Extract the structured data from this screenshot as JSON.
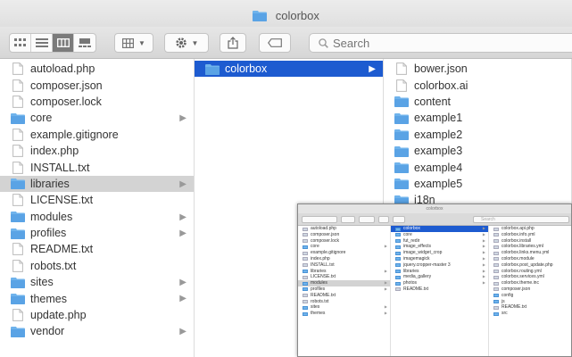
{
  "window": {
    "title": "colorbox",
    "search": {
      "placeholder": "Search"
    }
  },
  "columns": [
    {
      "items": [
        {
          "label": "autoload.php",
          "type": "file",
          "chevron": false,
          "selected": ""
        },
        {
          "label": "composer.json",
          "type": "file",
          "chevron": false,
          "selected": ""
        },
        {
          "label": "composer.lock",
          "type": "file",
          "chevron": false,
          "selected": ""
        },
        {
          "label": "core",
          "type": "folder",
          "chevron": true,
          "selected": ""
        },
        {
          "label": "example.gitignore",
          "type": "file",
          "chevron": false,
          "selected": ""
        },
        {
          "label": "index.php",
          "type": "file",
          "chevron": false,
          "selected": ""
        },
        {
          "label": "INSTALL.txt",
          "type": "file",
          "chevron": false,
          "selected": ""
        },
        {
          "label": "libraries",
          "type": "folder",
          "chevron": true,
          "selected": "gray"
        },
        {
          "label": "LICENSE.txt",
          "type": "file",
          "chevron": false,
          "selected": ""
        },
        {
          "label": "modules",
          "type": "folder",
          "chevron": true,
          "selected": ""
        },
        {
          "label": "profiles",
          "type": "folder",
          "chevron": true,
          "selected": ""
        },
        {
          "label": "README.txt",
          "type": "file",
          "chevron": false,
          "selected": ""
        },
        {
          "label": "robots.txt",
          "type": "file",
          "chevron": false,
          "selected": ""
        },
        {
          "label": "sites",
          "type": "folder",
          "chevron": true,
          "selected": ""
        },
        {
          "label": "themes",
          "type": "folder",
          "chevron": true,
          "selected": ""
        },
        {
          "label": "update.php",
          "type": "file",
          "chevron": false,
          "selected": ""
        },
        {
          "label": "vendor",
          "type": "folder",
          "chevron": true,
          "selected": ""
        }
      ]
    },
    {
      "items": [
        {
          "label": "colorbox",
          "type": "folder",
          "chevron": true,
          "selected": "blue"
        }
      ]
    },
    {
      "items": [
        {
          "label": "bower.json",
          "type": "file",
          "chevron": false,
          "selected": ""
        },
        {
          "label": "colorbox.ai",
          "type": "file",
          "chevron": false,
          "selected": ""
        },
        {
          "label": "content",
          "type": "folder",
          "chevron": false,
          "selected": ""
        },
        {
          "label": "example1",
          "type": "folder",
          "chevron": false,
          "selected": ""
        },
        {
          "label": "example2",
          "type": "folder",
          "chevron": false,
          "selected": ""
        },
        {
          "label": "example3",
          "type": "folder",
          "chevron": false,
          "selected": ""
        },
        {
          "label": "example4",
          "type": "folder",
          "chevron": false,
          "selected": ""
        },
        {
          "label": "example5",
          "type": "folder",
          "chevron": false,
          "selected": ""
        },
        {
          "label": "i18n",
          "type": "folder",
          "chevron": false,
          "selected": ""
        }
      ]
    }
  ],
  "inset": {
    "title": "colorbox",
    "search_placeholder": "Search",
    "columns": [
      {
        "items": [
          {
            "label": "autoload.php",
            "type": "file",
            "selected": ""
          },
          {
            "label": "composer.json",
            "type": "file",
            "selected": ""
          },
          {
            "label": "composer.lock",
            "type": "file",
            "selected": ""
          },
          {
            "label": "core",
            "type": "folder",
            "selected": ""
          },
          {
            "label": "example.gitignore",
            "type": "file",
            "selected": ""
          },
          {
            "label": "index.php",
            "type": "file",
            "selected": ""
          },
          {
            "label": "INSTALL.txt",
            "type": "file",
            "selected": ""
          },
          {
            "label": "libraries",
            "type": "folder",
            "selected": ""
          },
          {
            "label": "LICENSE.txt",
            "type": "file",
            "selected": ""
          },
          {
            "label": "modules",
            "type": "folder",
            "selected": "gray"
          },
          {
            "label": "profiles",
            "type": "folder",
            "selected": ""
          },
          {
            "label": "README.txt",
            "type": "file",
            "selected": ""
          },
          {
            "label": "robots.txt",
            "type": "file",
            "selected": ""
          },
          {
            "label": "sites",
            "type": "folder",
            "selected": ""
          },
          {
            "label": "themes",
            "type": "folder",
            "selected": ""
          }
        ]
      },
      {
        "items": [
          {
            "label": "colorbox",
            "type": "folder",
            "selected": "blue"
          },
          {
            "label": "core",
            "type": "folder",
            "selected": ""
          },
          {
            "label": "fut_redir",
            "type": "folder",
            "selected": ""
          },
          {
            "label": "image_effects",
            "type": "folder",
            "selected": ""
          },
          {
            "label": "image_widget_crop",
            "type": "folder",
            "selected": ""
          },
          {
            "label": "imagemagick",
            "type": "folder",
            "selected": ""
          },
          {
            "label": "jquery.cropper-master 3",
            "type": "folder",
            "selected": ""
          },
          {
            "label": "libraries",
            "type": "folder",
            "selected": ""
          },
          {
            "label": "media_gallery",
            "type": "folder",
            "selected": ""
          },
          {
            "label": "photos",
            "type": "folder",
            "selected": ""
          },
          {
            "label": "README.txt",
            "type": "file",
            "selected": ""
          }
        ]
      },
      {
        "items": [
          {
            "label": "colorbox.api.php",
            "type": "file",
            "selected": ""
          },
          {
            "label": "colorbox.info.yml",
            "type": "file",
            "selected": ""
          },
          {
            "label": "colorbox.install",
            "type": "file",
            "selected": ""
          },
          {
            "label": "colorbox.libraries.yml",
            "type": "file",
            "selected": ""
          },
          {
            "label": "colorbox.links.menu.yml",
            "type": "file",
            "selected": ""
          },
          {
            "label": "colorbox.module",
            "type": "file",
            "selected": ""
          },
          {
            "label": "colorbox.post_update.php",
            "type": "file",
            "selected": ""
          },
          {
            "label": "colorbox.routing.yml",
            "type": "file",
            "selected": ""
          },
          {
            "label": "colorbox.services.yml",
            "type": "file",
            "selected": ""
          },
          {
            "label": "colorbox.theme.inc",
            "type": "file",
            "selected": ""
          },
          {
            "label": "composer.json",
            "type": "file",
            "selected": ""
          },
          {
            "label": "config",
            "type": "folder",
            "selected": ""
          },
          {
            "label": "js",
            "type": "folder",
            "selected": ""
          },
          {
            "label": "README.txt",
            "type": "file",
            "selected": ""
          },
          {
            "label": "src",
            "type": "folder",
            "selected": ""
          }
        ]
      }
    ]
  },
  "colors": {
    "selection_blue": "#1d5bd0",
    "selection_gray": "#d3d3d3",
    "folder": "#6fb3ec"
  }
}
